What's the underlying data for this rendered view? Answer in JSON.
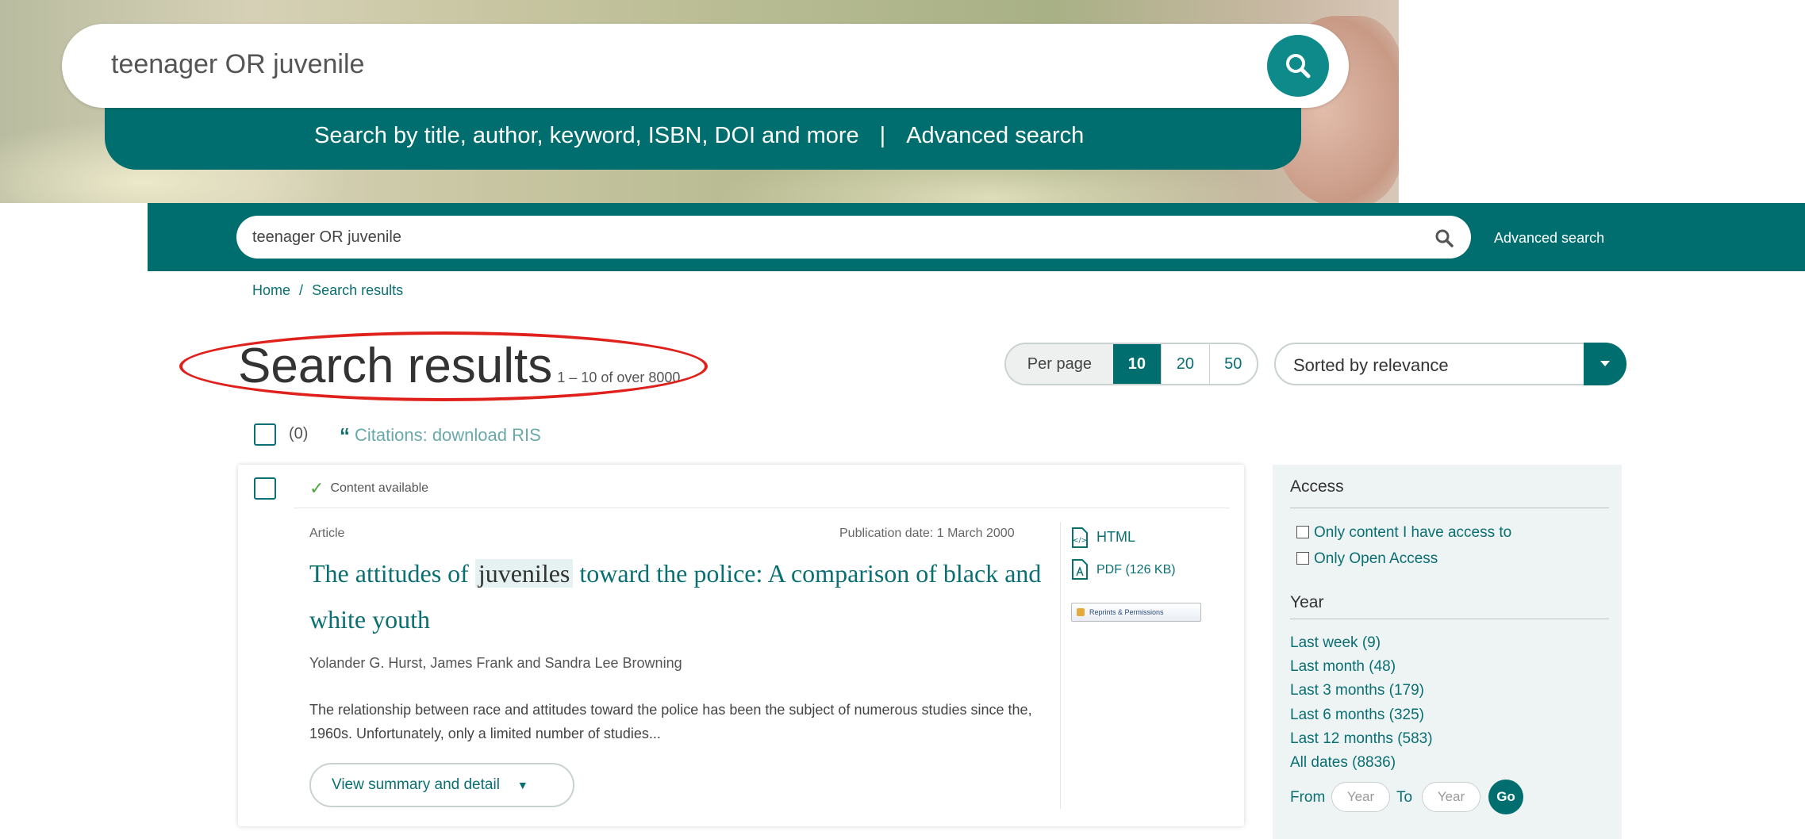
{
  "hero": {
    "search_value": "teenager OR juvenile",
    "subtitle": "Search by title, author, keyword, ISBN, DOI and more",
    "separator": "|",
    "advanced_link": "Advanced search"
  },
  "header": {
    "search_value": "teenager OR juvenile",
    "advanced_link": "Advanced search"
  },
  "breadcrumb": {
    "home": "Home",
    "separator": "/",
    "current": "Search results"
  },
  "results": {
    "title": "Search results",
    "range_text": "1 – 10 of over 8000"
  },
  "per_page": {
    "label": "Per page",
    "options": [
      "10",
      "20",
      "50"
    ],
    "selected": "10"
  },
  "sort": {
    "selected": "Sorted by relevance"
  },
  "selection": {
    "count_text": "(0)",
    "citations_quote": "“",
    "citations_text": "Citations: download RIS"
  },
  "result_item": {
    "status": "Content available",
    "type": "Article",
    "publication_date": "Publication date: 1 March 2000",
    "title_before": "The attitudes of ",
    "title_highlight": "juveniles",
    "title_after": " toward the police: A comparison of black and white youth",
    "authors": "Yolander G. Hurst, James Frank and Sandra Lee Browning",
    "abstract": "The relationship between race and attitudes toward the police has been the subject of numerous studies since the, 1960s. Unfortunately, only a limited number of studies...",
    "view_button": "View summary and detail",
    "formats": [
      {
        "label": "HTML",
        "icon": "html-file-icon"
      },
      {
        "label": "PDF (126 KB)",
        "icon": "pdf-file-icon"
      }
    ],
    "reprints": "Reprints & Permissions"
  },
  "filters": {
    "access": {
      "heading": "Access",
      "options": [
        "Only content I have access to",
        "Only Open Access"
      ]
    },
    "year": {
      "heading": "Year",
      "options": [
        "Last week (9)",
        "Last month (48)",
        "Last 3 months (179)",
        "Last 6 months (325)",
        "Last 12 months (583)",
        "All dates (8836)"
      ],
      "from_label": "From",
      "to_label": "To",
      "from_placeholder": "Year",
      "to_placeholder": "Year",
      "go_label": "Go"
    }
  },
  "colors": {
    "brand_teal": "#006e6e",
    "link_teal": "#0a6f72",
    "annotation_red": "#e0201b",
    "check_green": "#4fa83d"
  }
}
